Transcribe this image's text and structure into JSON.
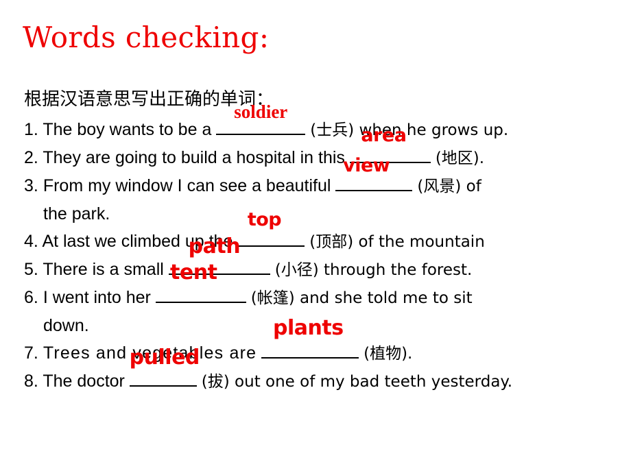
{
  "slide": {
    "title": "Words checking:",
    "title_color": "#ee0000",
    "text_color": "#000000",
    "background": "#ffffff",
    "instruction": "根据汉语意思写出正确的单词："
  },
  "questions": [
    {
      "number": "1.",
      "before": "The boy wants to be a",
      "answer": "soldier",
      "after": "(士兵) when he grows up.",
      "continuation": ""
    },
    {
      "number": "2.",
      "before": "They are going to build a hospital in this",
      "answer": "area",
      "after": "(地区).",
      "continuation": ""
    },
    {
      "number": "3.",
      "before": "From my window I can see a beautiful",
      "answer": "view",
      "after": "(风景) of",
      "continuation": "the park."
    },
    {
      "number": "4.",
      "before": "At last we climbed up the",
      "answer": "top",
      "after": "(顶部) of the mountain",
      "continuation": ""
    },
    {
      "number": "5.",
      "before": "There is a small",
      "answer": "path",
      "after": "(小径) through the forest.",
      "continuation": ""
    },
    {
      "number": "6.",
      "before": "I went into her",
      "answer": "tent",
      "after": "(帐篷) and she told me to sit",
      "continuation": "down."
    },
    {
      "number": "7.",
      "before": "Trees and vegetables are",
      "answer": "plants",
      "after": "(植物).",
      "continuation": ""
    },
    {
      "number": "8.",
      "before": "The doctor",
      "answer": "pulled",
      "after": "(拔) out one of my bad teeth yesterday.",
      "continuation": ""
    }
  ]
}
